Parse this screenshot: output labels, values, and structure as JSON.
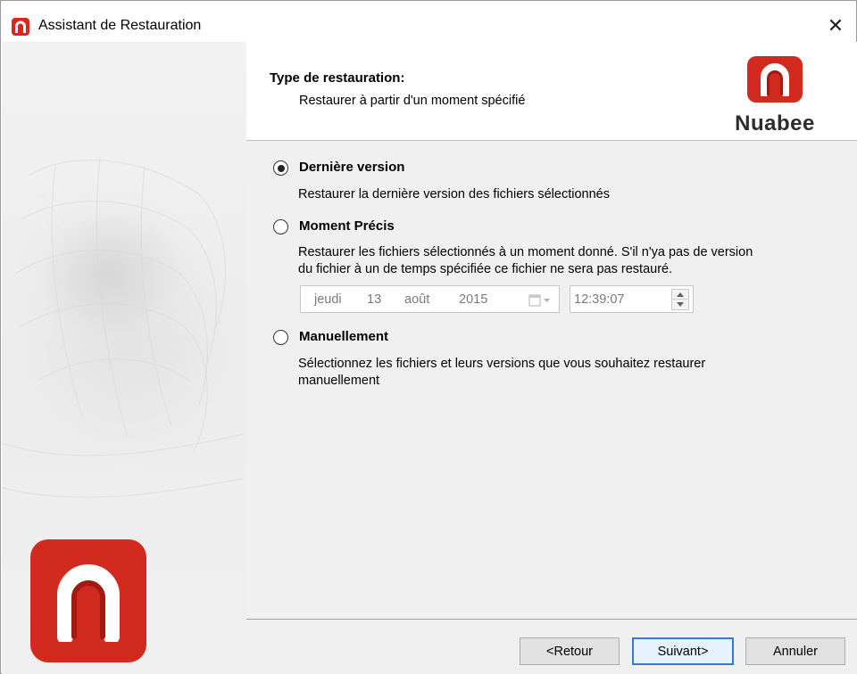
{
  "window": {
    "title": "Assistant de Restauration",
    "close_glyph": "✕",
    "app_icon": "nuabee-logo-icon"
  },
  "header": {
    "title": "Type de restauration:",
    "subtitle": "Restaurer à partir d'un moment spécifié",
    "brand": "Nuabee",
    "brand_color": "#d32a1f"
  },
  "options": [
    {
      "label": "Dernière version",
      "description": "Restaurer la dernière version des fichiers sélectionnés",
      "checked": true
    },
    {
      "label": "Moment Précis",
      "description_line1": "Restaurer les fichiers sélectionnés à un moment donné. S'il n'ya pas de version",
      "description_line2": "du fichier à un de temps spécifiée ce fichier ne sera pas restauré.",
      "checked": false
    },
    {
      "label": "Manuellement",
      "description_line1": "Sélectionnez les fichiers et leurs versions que vous souhaitez restaurer",
      "description_line2": "manuellement",
      "checked": false
    }
  ],
  "date_picker": {
    "day_name": "jeudi",
    "day": "13",
    "month": "août",
    "year": "2015",
    "enabled": false
  },
  "time_picker": {
    "value": "12:39:07",
    "enabled": false
  },
  "buttons": {
    "back": "<Retour",
    "next": "Suivant>",
    "cancel": "Annuler"
  }
}
